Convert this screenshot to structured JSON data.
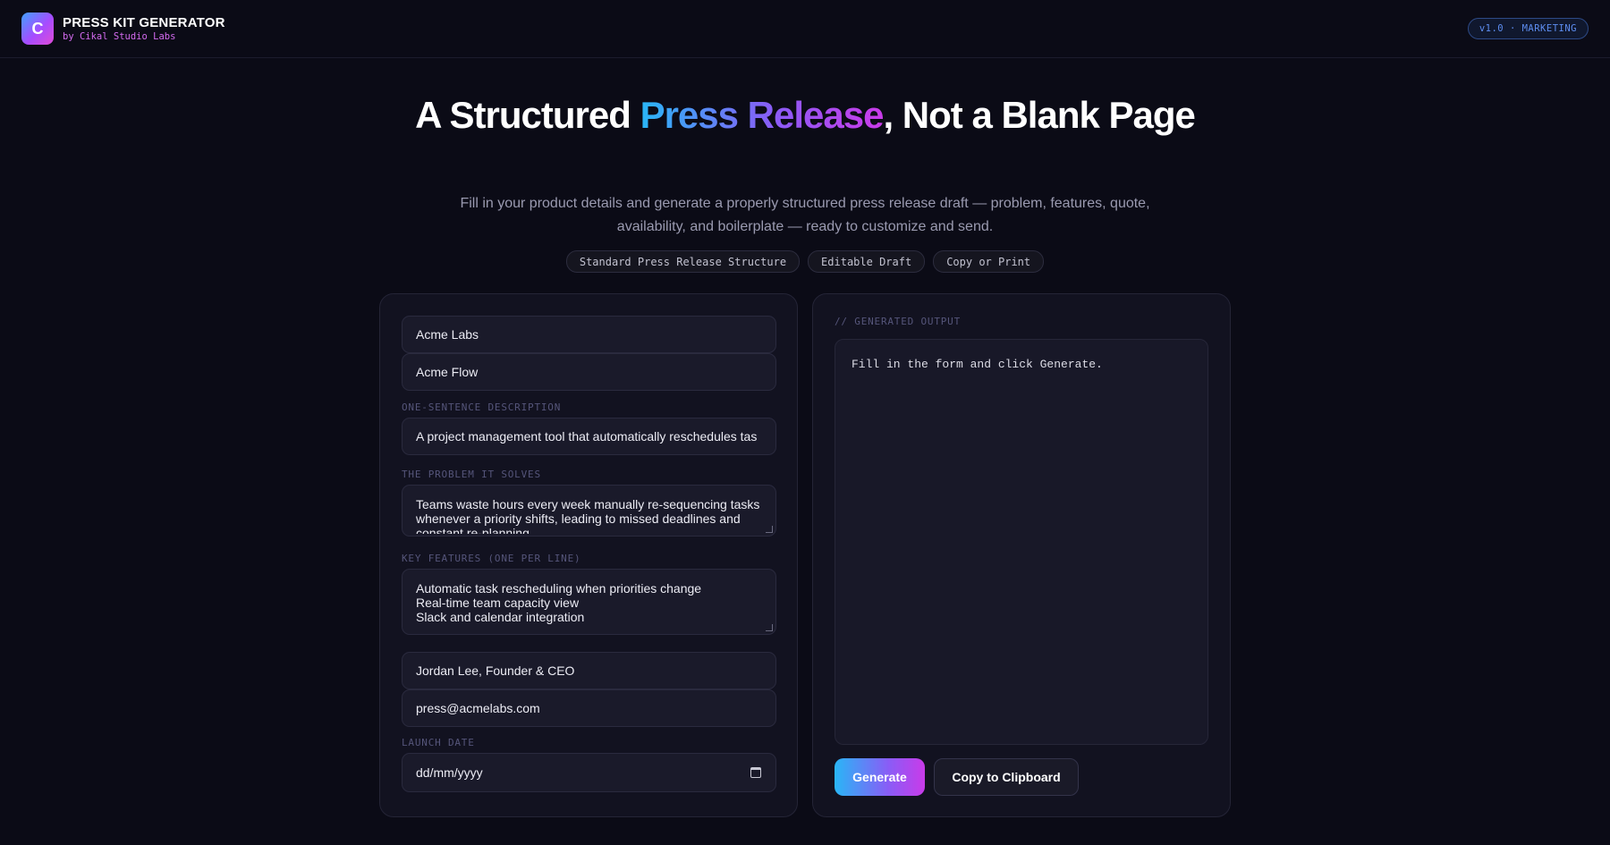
{
  "header": {
    "logo_letter": "C",
    "title": "PRESS KIT GENERATOR",
    "subtitle": "by Cikal Studio Labs",
    "version_badge": "v1.0 · MARKETING"
  },
  "hero": {
    "title_before": "A Structured ",
    "title_highlight": "Press Release",
    "title_after": ", Not a Blank Page",
    "description": "Fill in your product details and generate a properly structured press release draft — problem, features, quote, availability, and boilerplate — ready to customize and send.",
    "tags": [
      "Standard Press Release Structure",
      "Editable Draft",
      "Copy or Print"
    ]
  },
  "form": {
    "company_value": "Acme Labs",
    "product_value": "Acme Flow",
    "description_label": "ONE-SENTENCE DESCRIPTION",
    "description_value": "A project management tool that automatically reschedules tas",
    "problem_label": "THE PROBLEM IT SOLVES",
    "problem_lines": [
      "Teams waste hours every week manually re-sequencing tasks",
      "whenever a priority shifts, leading to missed deadlines and",
      "constant re-planning."
    ],
    "features_label": "KEY FEATURES (ONE PER LINE)",
    "features_lines": [
      "Automatic task rescheduling when priorities change",
      "Real-time team capacity view",
      "Slack and calendar integration"
    ],
    "spokesperson_value": "Jordan Lee, Founder & CEO",
    "contact_value": "press@acmelabs.com",
    "launch_label": "LAUNCH DATE",
    "launch_value": "dd/mm/yyyy"
  },
  "output": {
    "label": "// GENERATED OUTPUT",
    "placeholder": "Fill in the form and click Generate.",
    "generate_label": "Generate",
    "copy_label": "Copy to Clipboard"
  }
}
